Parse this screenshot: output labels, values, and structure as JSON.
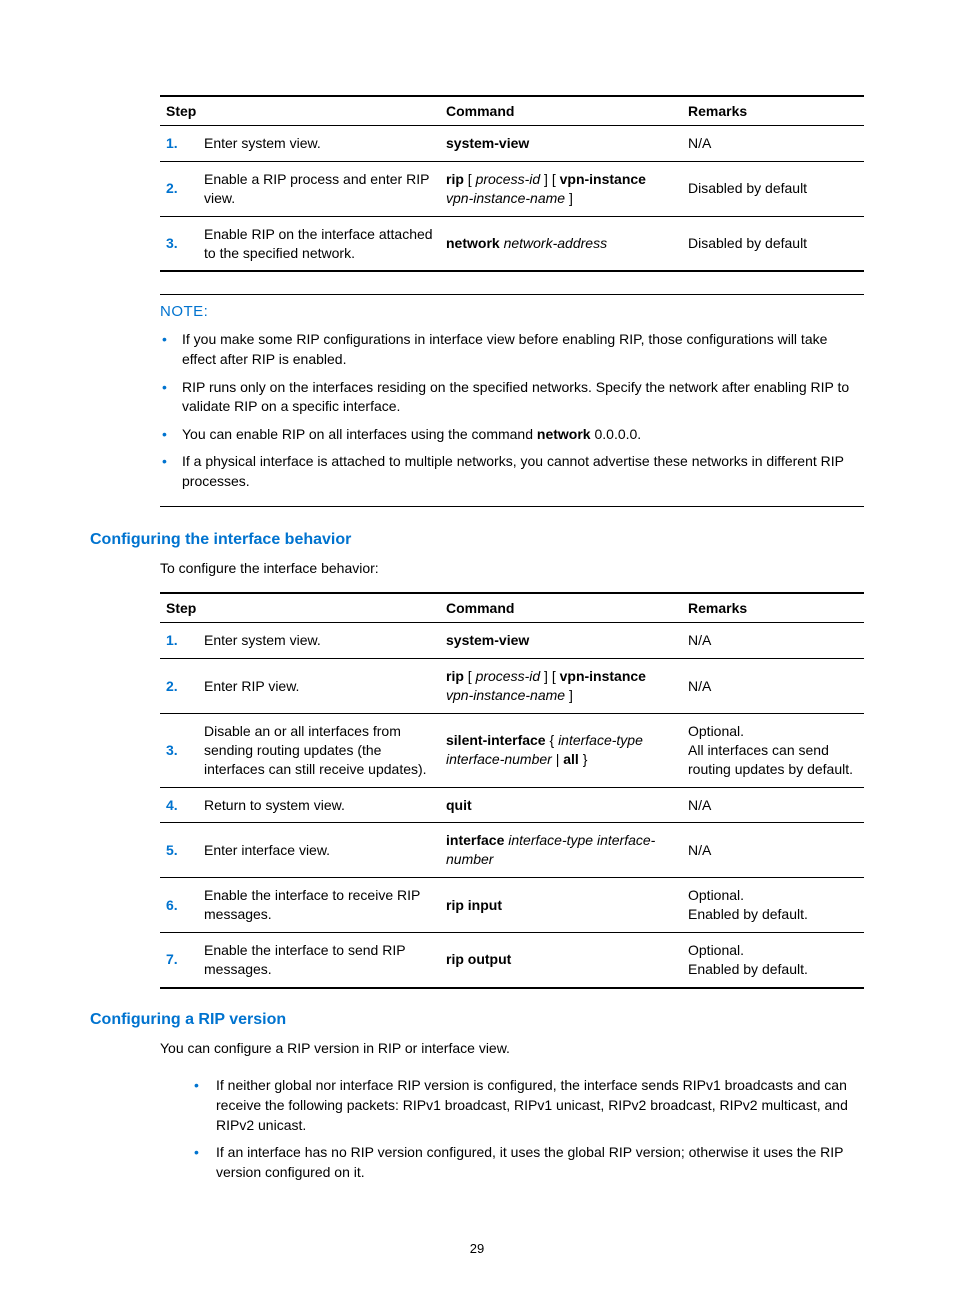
{
  "table1": {
    "headers": {
      "step": "Step",
      "command": "Command",
      "remarks": "Remarks"
    },
    "rows": [
      {
        "num": "1.",
        "step": "Enter system view.",
        "cmd_html": "<span class='bold'>system-view</span>",
        "remarks": "N/A"
      },
      {
        "num": "2.",
        "step": "Enable a RIP process and enter RIP view.",
        "cmd_html": "<span class='bold'>rip</span> [ <span class='italic'>process-id</span> ] [ <span class='bold'>vpn-instance</span> <span class='italic'>vpn-instance-name</span> ]",
        "remarks": "Disabled by default"
      },
      {
        "num": "3.",
        "step": "Enable RIP on the interface attached to the specified network.",
        "cmd_html": "<span class='bold'>network</span> <span class='italic'>network-address</span>",
        "remarks": "Disabled by default"
      }
    ]
  },
  "note_label": "NOTE:",
  "notes": [
    "If you make some RIP configurations in interface view before enabling RIP, those configurations will take effect after RIP is enabled.",
    "RIP runs only on the interfaces residing on the specified networks. Specify the network after enabling RIP to validate RIP on a specific interface.",
    "You can enable RIP on all interfaces using the command <span class='bold'>network</span> 0.0.0.0.",
    "If a physical interface is attached to multiple networks, you cannot advertise these networks in different RIP processes."
  ],
  "section2": {
    "title": "Configuring the interface behavior",
    "intro": "To configure the interface behavior:"
  },
  "table2": {
    "headers": {
      "step": "Step",
      "command": "Command",
      "remarks": "Remarks"
    },
    "rows": [
      {
        "num": "1.",
        "step": "Enter system view.",
        "cmd_html": "<span class='bold'>system-view</span>",
        "remarks_html": "N/A"
      },
      {
        "num": "2.",
        "step": "Enter RIP view.",
        "cmd_html": "<span class='bold'>rip</span> [ <span class='italic'>process-id</span> ] [ <span class='bold'>vpn-instance</span> <span class='italic'>vpn-instance-name</span> ]",
        "remarks_html": "N/A"
      },
      {
        "num": "3.",
        "step": "Disable an or all interfaces from sending routing updates (the interfaces can still receive updates).",
        "cmd_html": "<span class='bold'>silent-interface</span> { <span class='italic'>interface-type interface-number</span> | <span class='bold'>all</span> }",
        "remarks_html": "Optional.<br>All interfaces can send routing updates by default."
      },
      {
        "num": "4.",
        "step": "Return to system view.",
        "cmd_html": "<span class='bold'>quit</span>",
        "remarks_html": "N/A"
      },
      {
        "num": "5.",
        "step": "Enter interface view.",
        "cmd_html": "<span class='bold'>interface</span> <span class='italic'>interface-type interface-number</span>",
        "remarks_html": "N/A"
      },
      {
        "num": "6.",
        "step": "Enable the interface to receive RIP messages.",
        "cmd_html": "<span class='bold'>rip input</span>",
        "remarks_html": "Optional.<br>Enabled by default."
      },
      {
        "num": "7.",
        "step": "Enable the interface to send RIP messages.",
        "cmd_html": "<span class='bold'>rip output</span>",
        "remarks_html": "Optional.<br>Enabled by default."
      }
    ]
  },
  "section3": {
    "title": "Configuring a RIP version",
    "intro": "You can configure a RIP version in RIP or interface view.",
    "bullets": [
      "If neither global nor interface RIP version is configured, the interface sends RIPv1 broadcasts and can receive the following packets: RIPv1 broadcast, RIPv1 unicast, RIPv2 broadcast, RIPv2 multicast, and RIPv2 unicast.",
      "If an interface has no RIP version configured, it uses the global RIP version; otherwise it uses the RIP version configured on it."
    ]
  },
  "page_number": "29"
}
